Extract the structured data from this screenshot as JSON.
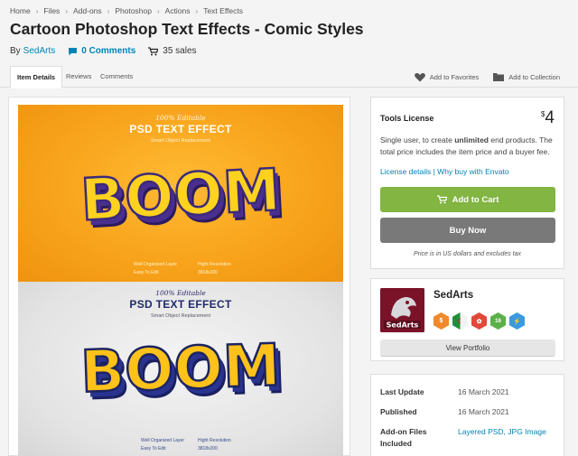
{
  "breadcrumb": [
    "Home",
    "Files",
    "Add-ons",
    "Photoshop",
    "Actions",
    "Text Effects"
  ],
  "title": "Cartoon Photoshop Text Effects - Comic Styles",
  "meta": {
    "by": "By",
    "author": "SedArts",
    "comments": "0 Comments",
    "sales": "35 sales"
  },
  "tabs": {
    "item_details": "Item Details",
    "reviews": "Reviews",
    "comments": "Comments"
  },
  "actions": {
    "favorites": "Add to Favorites",
    "collection": "Add to Collection"
  },
  "preview": {
    "top": {
      "editable": "100% Editable",
      "headline": "PSD TEXT EFFECT",
      "sub": "Smart Object Replacement",
      "word": "BOOM",
      "f1": "Well Organized Layer",
      "f2": "Easy To Edit",
      "f3": "Hight Resolution",
      "f4": "3818x200"
    },
    "bottom": {
      "editable": "100% Editable",
      "headline": "PSD TEXT EFFECT",
      "sub": "Smart Object Replacement",
      "word": "BOOM",
      "f1": "Well Organized Layer",
      "f2": "Easy To Edit",
      "f3": "Hight Resolution",
      "f4": "3818x200"
    }
  },
  "license": {
    "title": "Tools License",
    "currency": "$",
    "price": "4",
    "desc_pre": "Single user, to create ",
    "desc_bold": "unlimited",
    "desc_post": " end products. The total price includes the item price and a buyer fee.",
    "details_link": "License details",
    "why_link": "Why buy with Envato",
    "add_to_cart": "Add to Cart",
    "buy_now": "Buy Now",
    "note": "Price is in US dollars and excludes tax"
  },
  "author_box": {
    "name": "SedArts",
    "logo_text": "SedArts",
    "portfolio": "View Portfolio",
    "badge_count": "16"
  },
  "details": [
    {
      "key": "Last Update",
      "value": "16 March 2021"
    },
    {
      "key": "Published",
      "value": "16 March 2021"
    },
    {
      "key": "Add-on Files Included",
      "value": "Layered PSD, JPG Image"
    }
  ],
  "colors": {
    "accent_blue": "#0084b4",
    "cart_green": "#82b541",
    "buy_gray": "#797979",
    "banner_orange": "#f7a21a"
  }
}
